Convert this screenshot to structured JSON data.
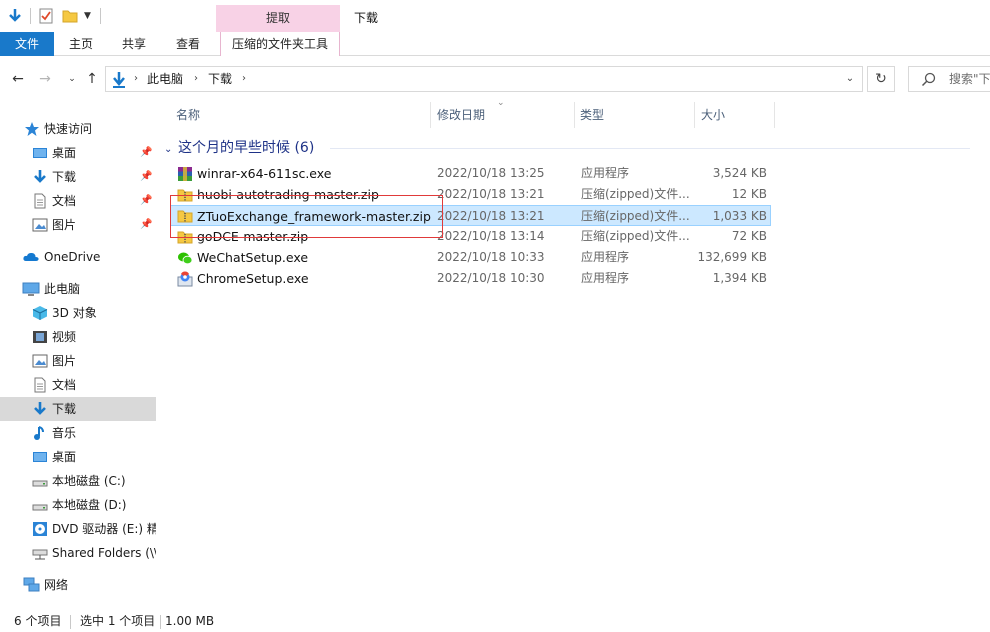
{
  "window": {
    "title": "下载"
  },
  "ribbon": {
    "context_group": "提取",
    "tabs": [
      {
        "label": "文件",
        "active": true
      },
      {
        "label": "主页"
      },
      {
        "label": "共享"
      },
      {
        "label": "查看"
      },
      {
        "label": "压缩的文件夹工具"
      }
    ]
  },
  "address": {
    "breadcrumbs": [
      "此电脑",
      "下载"
    ],
    "search_placeholder": "搜索\"下载\""
  },
  "nav_pane": {
    "items": [
      {
        "label": "快速访问",
        "icon": "star-icon"
      },
      {
        "label": "桌面",
        "icon": "desktop-icon",
        "pinned": true
      },
      {
        "label": "下载",
        "icon": "download-icon",
        "pinned": true
      },
      {
        "label": "文档",
        "icon": "document-icon",
        "pinned": true
      },
      {
        "label": "图片",
        "icon": "picture-icon",
        "pinned": true
      },
      {
        "label": "OneDrive",
        "icon": "cloud-icon"
      },
      {
        "label": "此电脑",
        "icon": "computer-icon"
      },
      {
        "label": "3D 对象",
        "icon": "cube-icon"
      },
      {
        "label": "视频",
        "icon": "video-icon"
      },
      {
        "label": "图片",
        "icon": "picture-icon"
      },
      {
        "label": "文档",
        "icon": "document-icon"
      },
      {
        "label": "下载",
        "icon": "download-icon",
        "selected": true
      },
      {
        "label": "音乐",
        "icon": "music-icon"
      },
      {
        "label": "桌面",
        "icon": "desktop-icon"
      },
      {
        "label": "本地磁盘 (C:)",
        "icon": "drive-icon"
      },
      {
        "label": "本地磁盘 (D:)",
        "icon": "drive-icon"
      },
      {
        "label": "DVD 驱动器 (E:) 精",
        "icon": "dvd-icon"
      },
      {
        "label": "Shared Folders (\\\\",
        "icon": "network-drive-icon"
      },
      {
        "label": "网络",
        "icon": "network-icon"
      }
    ]
  },
  "columns": {
    "name": "名称",
    "date": "修改日期",
    "type": "类型",
    "size": "大小"
  },
  "group": {
    "label": "这个月的早些时候 (6)"
  },
  "files": [
    {
      "name": "winrar-x64-611sc.exe",
      "date": "2022/10/18 13:25",
      "type": "应用程序",
      "size": "3,524 KB",
      "icon": "winrar-icon"
    },
    {
      "name": "huobi-autotrading-master.zip",
      "date": "2022/10/18 13:21",
      "type": "压缩(zipped)文件...",
      "size": "12 KB",
      "icon": "zip-folder-icon"
    },
    {
      "name": "ZTuoExchange_framework-master.zip",
      "date": "2022/10/18 13:21",
      "type": "压缩(zipped)文件...",
      "size": "1,033 KB",
      "icon": "zip-folder-icon",
      "selected": true
    },
    {
      "name": "goDCE-master.zip",
      "date": "2022/10/18 13:14",
      "type": "压缩(zipped)文件...",
      "size": "72 KB",
      "icon": "zip-folder-icon"
    },
    {
      "name": "WeChatSetup.exe",
      "date": "2022/10/18 10:33",
      "type": "应用程序",
      "size": "132,699 KB",
      "icon": "wechat-icon"
    },
    {
      "name": "ChromeSetup.exe",
      "date": "2022/10/18 10:30",
      "type": "应用程序",
      "size": "1,394 KB",
      "icon": "chrome-setup-icon"
    }
  ],
  "status": {
    "count": "6 个项目",
    "selected": "选中 1 个项目",
    "size": "1.00 MB"
  },
  "colors": {
    "accent": "#1979ca",
    "selection": "#cce8ff",
    "context_tab": "#f8d2e6",
    "annotation": "#e03a3a"
  }
}
